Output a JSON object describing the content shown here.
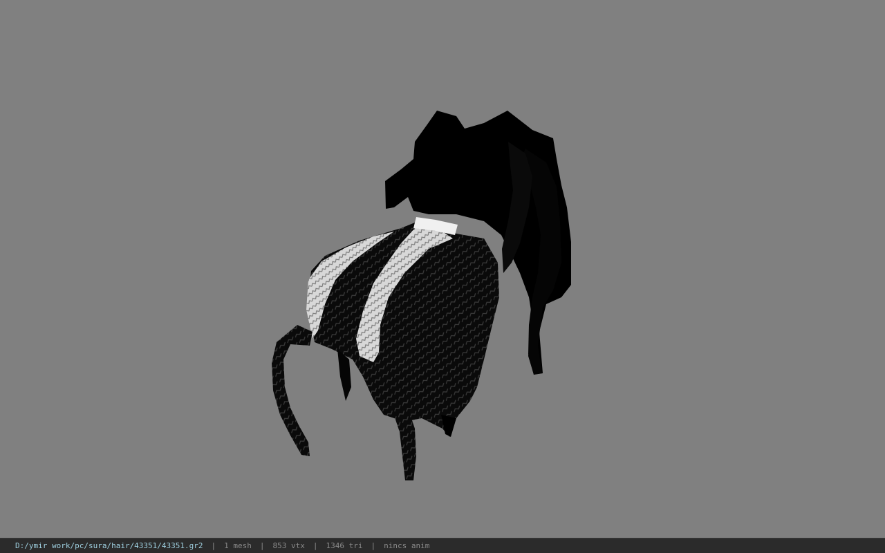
{
  "viewer": {
    "background_color": "#808080",
    "model_colors": {
      "hair": "#000000",
      "highlight": "#e0e0e0",
      "band": "#f0f0f0"
    }
  },
  "statusbar": {
    "path": "D:/ymir work/pc/sura/hair/43351/43351.gr2",
    "separator": "|",
    "mesh_count": "1 mesh",
    "vertex_count": "853 vtx",
    "triangle_count": "1346 tri",
    "anim_status": "nincs anim",
    "path_color": "#9fd0e0",
    "text_color": "#8a8a8a"
  }
}
